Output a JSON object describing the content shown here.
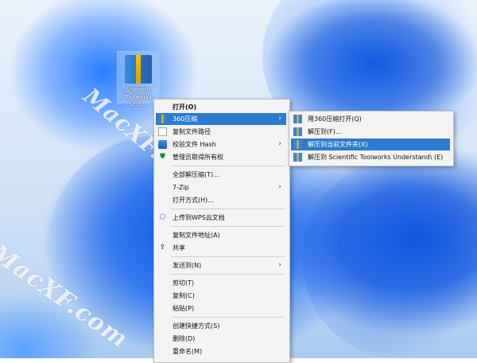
{
  "desktop_icon": {
    "label": "Scientific Toolworks Und..."
  },
  "watermarks": [
    "MacXF.com",
    "MacXF.com"
  ],
  "context_menu": {
    "items": [
      {
        "label": "打开(O)",
        "icon": ""
      },
      {
        "label": "360压缩",
        "icon": "360zip-icon",
        "has_submenu": true,
        "highlighted": true
      },
      {
        "label": "复制文件路径",
        "icon": "copy-path-icon"
      },
      {
        "label": "校验文件 Hash",
        "icon": "hash-icon",
        "has_submenu": true
      },
      {
        "label": "管理员取得所有权",
        "icon": "shield-icon"
      },
      {
        "label": "全部解压缩(T)...",
        "icon": ""
      },
      {
        "label": "7-Zip",
        "icon": "",
        "has_submenu": true
      },
      {
        "label": "打开方式(H)...",
        "icon": ""
      },
      {
        "label": "上传到WPS云文档",
        "icon": "cloud-cube-icon"
      },
      {
        "label": "复制文件地址(A)",
        "icon": ""
      },
      {
        "label": "共享",
        "icon": "share-icon"
      },
      {
        "label": "发送到(N)",
        "icon": "",
        "has_submenu": true
      },
      {
        "label": "剪切(T)",
        "icon": ""
      },
      {
        "label": "复制(C)",
        "icon": ""
      },
      {
        "label": "粘贴(P)",
        "icon": ""
      },
      {
        "label": "创建快捷方式(S)",
        "icon": ""
      },
      {
        "label": "删除(D)",
        "icon": ""
      },
      {
        "label": "重命名(M)",
        "icon": ""
      }
    ],
    "arrow_glyph": "›"
  },
  "submenu": {
    "items": [
      {
        "label": "用360压缩打开(Q)",
        "icon": "360zip-icon"
      },
      {
        "label": "解压到(F)...",
        "icon": "360zip-icon"
      },
      {
        "label": "解压到当前文件夹(X)",
        "icon": "360zip-icon",
        "highlighted": true
      },
      {
        "label": "解压到 Scientific Toolworks Understand\\ (E)",
        "icon": "360zip-icon"
      }
    ]
  },
  "colors": {
    "highlight": "#2c7bd1",
    "menu_bg": "#f3f3f3"
  }
}
